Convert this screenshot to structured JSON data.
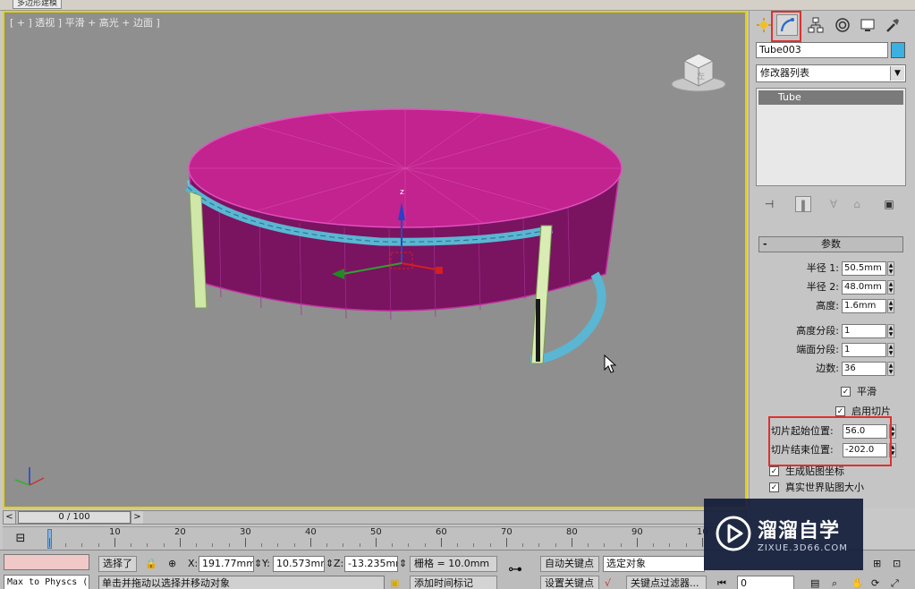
{
  "window": {
    "title_tab": "多边形建模"
  },
  "viewport": {
    "label": "[ + ] 透视 ] 平滑 + 高光 + 边面 ]",
    "viewcube_face": "左",
    "gizmo_axis_label": "z"
  },
  "command_panel": {
    "tabs": [
      "create-icon",
      "modify-icon",
      "hierarchy-icon",
      "motion-icon",
      "display-icon",
      "utilities-icon"
    ],
    "object_name": "Tube003",
    "object_color": "#3cb0e0",
    "modifier_list": "修改器列表",
    "stack_items": [
      "Tube"
    ],
    "rollout_title": "参数",
    "rollout_toggle": "-",
    "params": [
      {
        "label": "半径 1:",
        "value": "50.5mm"
      },
      {
        "label": "半径 2:",
        "value": "48.0mm"
      },
      {
        "label": "高度:",
        "value": "1.6mm"
      },
      {
        "label": "高度分段:",
        "value": "1"
      },
      {
        "label": "端面分段:",
        "value": "1"
      },
      {
        "label": "边数:",
        "value": "36"
      }
    ],
    "smooth_label": "平滑",
    "slice_on_label": "启用切片",
    "slice_from_label": "切片起始位置:",
    "slice_from_value": "56.0",
    "slice_to_label": "切片结束位置:",
    "slice_to_value": "-202.0",
    "gen_mapping_label": "生成贴图坐标",
    "real_world_label": "真实世界贴图大小",
    "checked_mark": "✓"
  },
  "timeline": {
    "frame_display": "0 / 100",
    "prev": "<",
    "next": ">",
    "ticks": [
      "10",
      "20",
      "30",
      "40",
      "50",
      "60",
      "70",
      "80",
      "90",
      "10"
    ]
  },
  "status": {
    "script_label": "Max to Physcs (",
    "selected": "选择了",
    "x_label": "X:",
    "x_value": "191.77mm",
    "y_label": "Y:",
    "y_value": "10.573mm",
    "z_label": "Z:",
    "z_value": "-13.235mm",
    "grid": "栅格 = 10.0mm",
    "prompt": "单击并拖动以选择并移动对象",
    "add_time_tag": "添加时间标记",
    "auto_key": "自动关键点",
    "set_key": "设置关键点",
    "selection_set": "选定对象",
    "key_filters": "关键点过滤器...",
    "frame_field": "0"
  },
  "watermark": {
    "title": "溜溜自学",
    "subtitle": "ZIXUE.3D66.COM"
  }
}
